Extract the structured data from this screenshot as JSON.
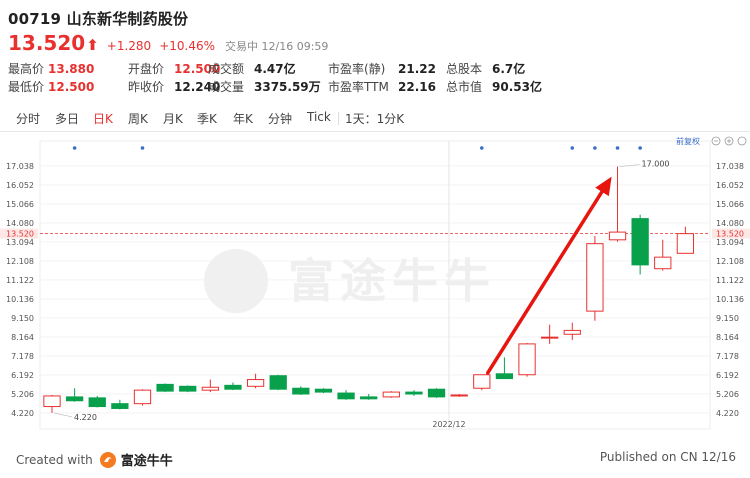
{
  "header": {
    "title": "00719 山东新华制药股份",
    "price": "13.520",
    "price_arrow": "⬆",
    "change": "+1.280",
    "change_pct": "+10.46%",
    "status": "交易中  12/16 09:59"
  },
  "stats": [
    {
      "label": "最高价",
      "value": "13.880",
      "color": "red"
    },
    {
      "label": "开盘价",
      "value": "12.500",
      "color": "red"
    },
    {
      "label": "成交额",
      "value": "4.47亿",
      "color": "plain"
    },
    {
      "label": "市盈率(静)",
      "value": "21.22",
      "color": "plain"
    },
    {
      "label": "总股本",
      "value": "6.7亿",
      "color": "plain"
    },
    {
      "label": "最低价",
      "value": "12.500",
      "color": "red"
    },
    {
      "label": "昨收价",
      "value": "12.240",
      "color": "plain"
    },
    {
      "label": "成交量",
      "value": "3375.59万",
      "color": "plain"
    },
    {
      "label": "市盈率TTM",
      "value": "22.16",
      "color": "plain"
    },
    {
      "label": "总市值",
      "value": "90.53亿",
      "color": "plain"
    }
  ],
  "tabs": [
    "分时",
    "多日",
    "日K",
    "周K",
    "月K",
    "季K",
    "年K",
    "分钟",
    "Tick",
    "1天：1分K"
  ],
  "active_tab": "日K",
  "chart": {
    "rights_label": "前复权",
    "watermark": "富途牛牛",
    "date_label": "2022/12",
    "high_annotation": "17.000",
    "low_annotation": "4.220",
    "current_price_tag": "13.520",
    "y_ticks": [
      "17.038",
      "16.052",
      "15.066",
      "14.080",
      "13.094",
      "12.108",
      "11.122",
      "10.136",
      "9.150",
      "8.164",
      "7.178",
      "6.192",
      "5.206",
      "4.220"
    ]
  },
  "chart_data": {
    "type": "candlestick",
    "ylim": [
      3.8,
      17.6
    ],
    "candles": [
      {
        "o": 4.55,
        "c": 5.1,
        "h": 5.15,
        "l": 4.22
      },
      {
        "o": 5.05,
        "c": 4.85,
        "h": 5.5,
        "l": 4.8
      },
      {
        "o": 5.0,
        "c": 4.55,
        "h": 5.1,
        "l": 4.5
      },
      {
        "o": 4.7,
        "c": 4.45,
        "h": 4.9,
        "l": 4.4
      },
      {
        "o": 4.7,
        "c": 5.4,
        "h": 5.45,
        "l": 4.6
      },
      {
        "o": 5.7,
        "c": 5.35,
        "h": 5.75,
        "l": 5.3
      },
      {
        "o": 5.6,
        "c": 5.35,
        "h": 5.65,
        "l": 5.3
      },
      {
        "o": 5.4,
        "c": 5.55,
        "h": 5.95,
        "l": 5.3
      },
      {
        "o": 5.65,
        "c": 5.45,
        "h": 5.8,
        "l": 5.4
      },
      {
        "o": 5.6,
        "c": 5.95,
        "h": 6.25,
        "l": 5.5
      },
      {
        "o": 6.15,
        "c": 5.45,
        "h": 6.2,
        "l": 5.4
      },
      {
        "o": 5.5,
        "c": 5.2,
        "h": 5.6,
        "l": 5.15
      },
      {
        "o": 5.45,
        "c": 5.3,
        "h": 5.5,
        "l": 5.25
      },
      {
        "o": 5.25,
        "c": 4.95,
        "h": 5.4,
        "l": 4.9
      },
      {
        "o": 5.05,
        "c": 4.95,
        "h": 5.2,
        "l": 4.9
      },
      {
        "o": 5.05,
        "c": 5.3,
        "h": 5.35,
        "l": 5.0
      },
      {
        "o": 5.3,
        "c": 5.2,
        "h": 5.4,
        "l": 5.1
      },
      {
        "o": 5.45,
        "c": 5.05,
        "h": 5.5,
        "l": 5.0
      },
      {
        "o": 5.1,
        "c": 5.15,
        "h": 5.2,
        "l": 5.05
      },
      {
        "o": 5.5,
        "c": 6.2,
        "h": 6.2,
        "l": 5.4
      },
      {
        "o": 6.25,
        "c": 6.0,
        "h": 7.1,
        "l": 6.0
      },
      {
        "o": 6.2,
        "c": 7.8,
        "h": 7.85,
        "l": 6.1
      },
      {
        "o": 8.1,
        "c": 8.15,
        "h": 8.8,
        "l": 7.8
      },
      {
        "o": 8.3,
        "c": 8.5,
        "h": 8.9,
        "l": 8.0
      },
      {
        "o": 9.5,
        "c": 13.0,
        "h": 13.4,
        "l": 9.0
      },
      {
        "o": 13.2,
        "c": 13.6,
        "h": 17.0,
        "l": 13.1
      },
      {
        "o": 14.3,
        "c": 11.9,
        "h": 14.5,
        "l": 11.4
      },
      {
        "o": 11.7,
        "c": 12.3,
        "h": 13.2,
        "l": 11.6
      },
      {
        "o": 12.5,
        "c": 13.52,
        "h": 13.88,
        "l": 12.5
      }
    ],
    "markers": [
      1,
      4,
      19,
      23,
      24,
      25,
      26
    ]
  },
  "footer": {
    "created_with": "Created with",
    "brand": "富途牛牛",
    "published": "Published on CN 12/16"
  },
  "colors": {
    "up": "#e8312f",
    "down": "#09a04c",
    "accent": "#e8312f",
    "marker": "#3a6fc9"
  }
}
